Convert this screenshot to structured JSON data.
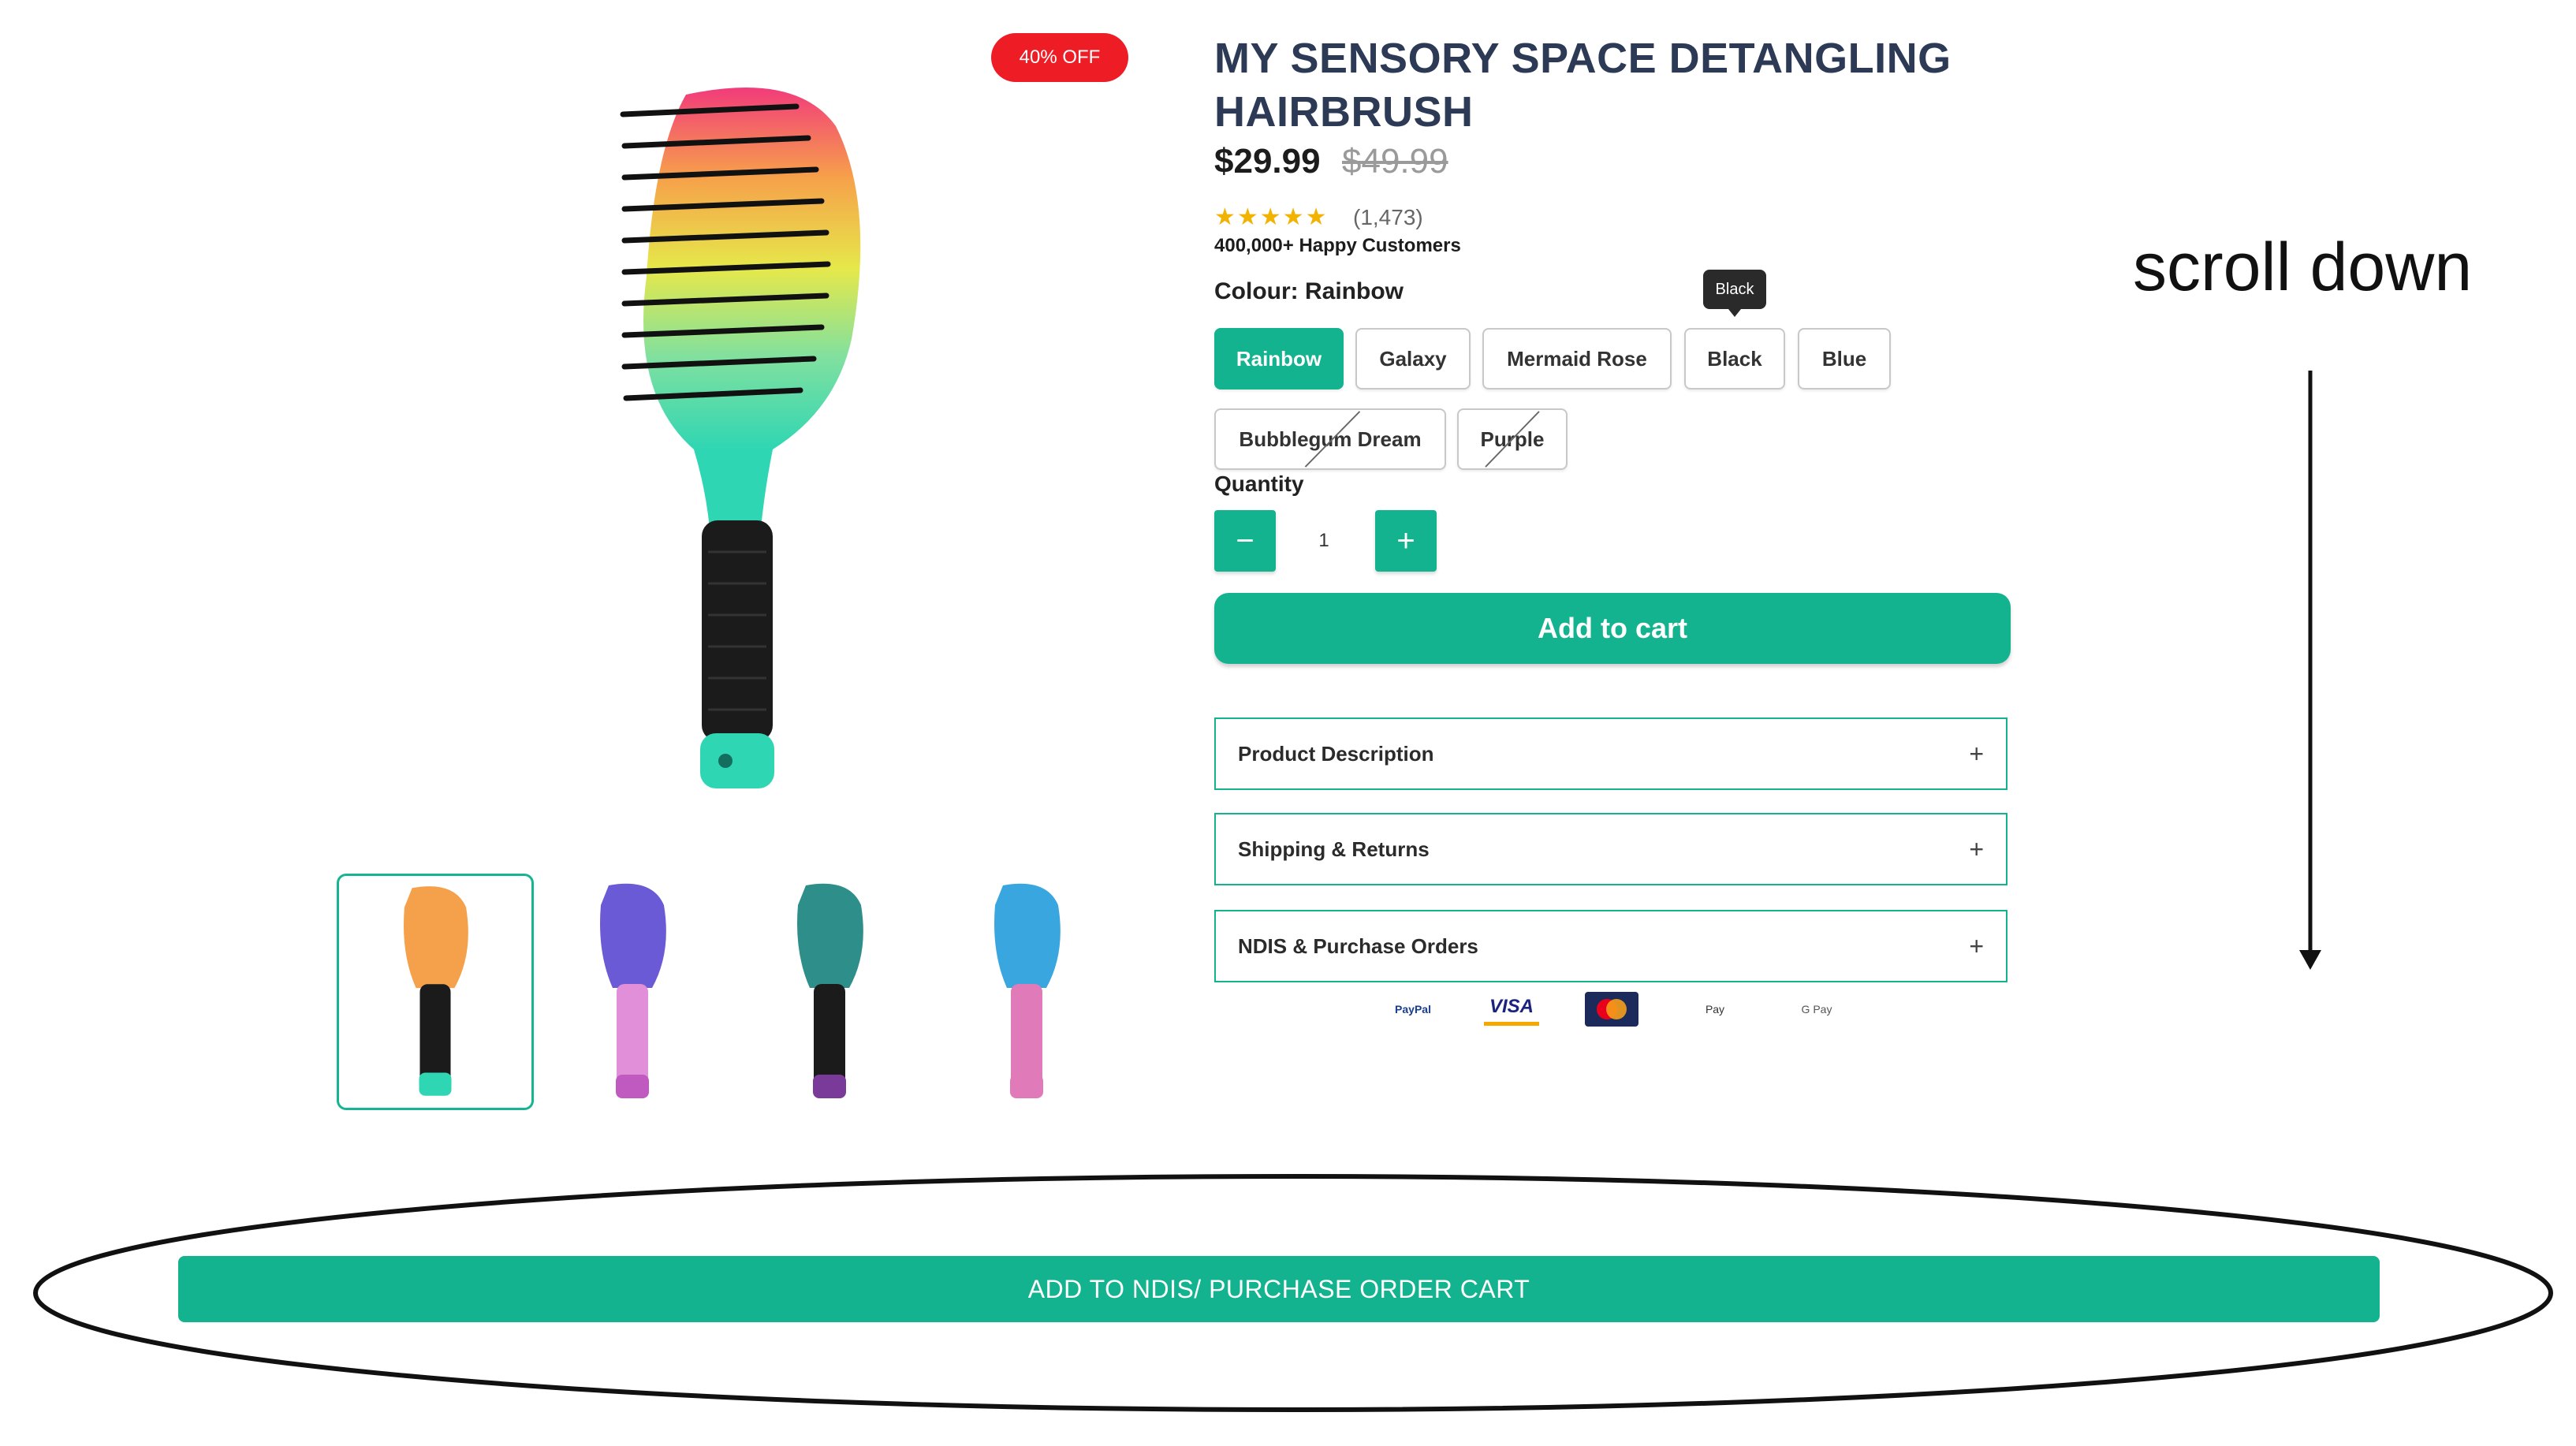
{
  "badge": {
    "label": "40% OFF"
  },
  "product": {
    "title": "MY SENSORY SPACE DETANGLING HAIRBRUSH",
    "price": "$29.99",
    "old_price": "$49.99",
    "stars": "★★★★★",
    "review_count": "(1,473)",
    "happy_customers": "400,000+ Happy Customers"
  },
  "colour": {
    "label": "Colour:",
    "selected": "Rainbow",
    "tooltip": "Black",
    "options": [
      "Rainbow",
      "Galaxy",
      "Mermaid Rose",
      "Black",
      "Blue",
      "Bubblegum Dream",
      "Purple"
    ],
    "unavailable": [
      "Bubblegum Dream",
      "Purple"
    ]
  },
  "quantity": {
    "label": "Quantity",
    "minus": "−",
    "value": "1",
    "plus": "+"
  },
  "cart": {
    "add_label": "Add to cart"
  },
  "accordions": [
    {
      "label": "Product Description",
      "icon": "+"
    },
    {
      "label": "Shipping & Returns",
      "icon": "+"
    },
    {
      "label": "NDIS & Purchase Orders",
      "icon": "+"
    }
  ],
  "payments": [
    "PayPal",
    "VISA",
    "Mastercard",
    "Pay",
    "G Pay"
  ],
  "annotation": {
    "scroll_text": "scroll down",
    "ndis_button": "ADD TO NDIS/ PURCHASE ORDER CART"
  },
  "colors": {
    "accent": "#14b38f",
    "badge": "#ee1c25",
    "title": "#2d3a55"
  }
}
